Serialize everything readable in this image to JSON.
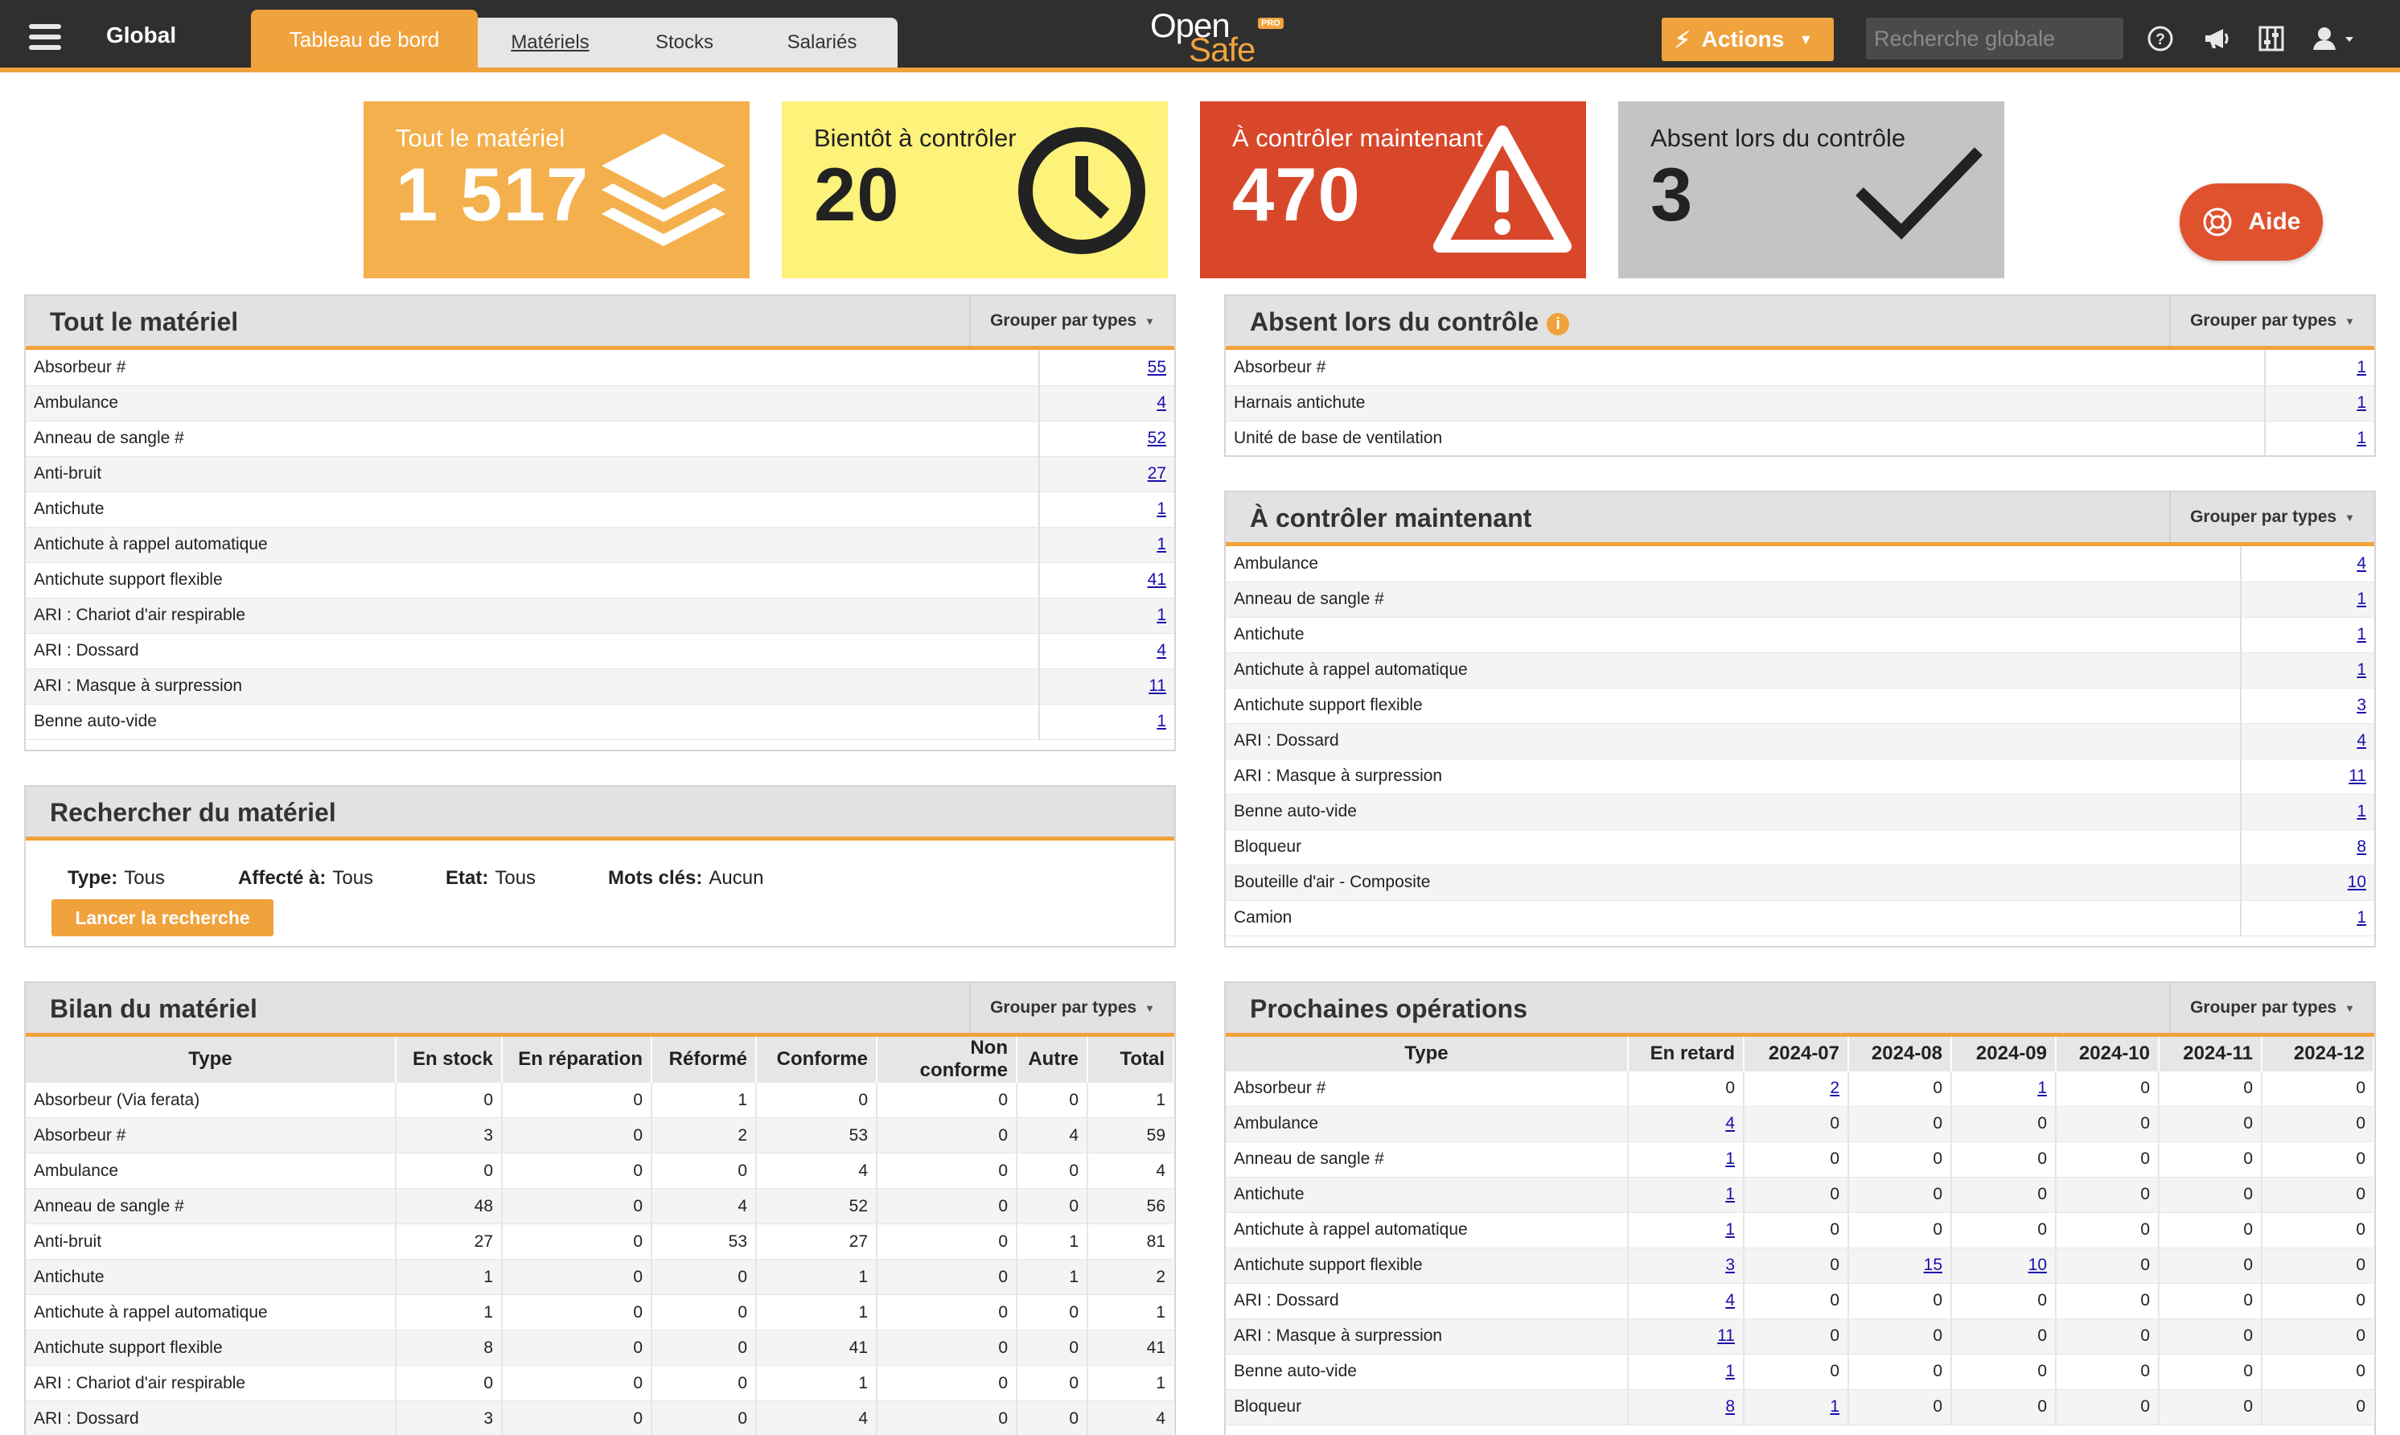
{
  "header": {
    "context": "Global",
    "tabs": [
      {
        "label": "Tableau de bord"
      },
      {
        "label": "Matériels"
      },
      {
        "label": "Stocks"
      },
      {
        "label": "Salariés"
      }
    ],
    "logo_top": "Open",
    "logo_bottom": "Safe",
    "logo_badge": "PRO",
    "actions_label": "Actions",
    "search_placeholder": "Recherche globale",
    "accent_color": "#f0a23c"
  },
  "kpis": [
    {
      "title": "Tout le matériel",
      "value": "1 517",
      "icon": "layers-icon",
      "color": "#f3b04c"
    },
    {
      "title": "Bientôt à contrôler",
      "value": "20",
      "icon": "clock-icon",
      "color": "#fdf27a"
    },
    {
      "title": "À contrôler maintenant",
      "value": "470",
      "icon": "warning-icon",
      "color": "#d9472b"
    },
    {
      "title": "Absent lors du contrôle",
      "value": "3",
      "icon": "check-icon",
      "color": "#c4c4c4"
    }
  ],
  "help_label": "Aide",
  "group_label": "Grouper par types",
  "all_equipment": {
    "title": "Tout le matériel",
    "rows": [
      {
        "type": "Absorbeur #",
        "count": "55"
      },
      {
        "type": "Ambulance",
        "count": "4"
      },
      {
        "type": "Anneau de sangle #",
        "count": "52"
      },
      {
        "type": "Anti-bruit",
        "count": "27"
      },
      {
        "type": "Antichute",
        "count": "1"
      },
      {
        "type": "Antichute à rappel automatique",
        "count": "1"
      },
      {
        "type": "Antichute support flexible",
        "count": "41"
      },
      {
        "type": "ARI : Chariot d'air respirable",
        "count": "1"
      },
      {
        "type": "ARI : Dossard",
        "count": "4"
      },
      {
        "type": "ARI : Masque à surpression",
        "count": "11"
      },
      {
        "type": "Benne auto-vide",
        "count": "1"
      }
    ]
  },
  "absent": {
    "title": "Absent lors du contrôle",
    "rows": [
      {
        "type": "Absorbeur #",
        "count": "1"
      },
      {
        "type": "Harnais antichute",
        "count": "1"
      },
      {
        "type": "Unité de base de ventilation",
        "count": "1"
      }
    ]
  },
  "to_check": {
    "title": "À contrôler maintenant",
    "rows": [
      {
        "type": "Ambulance",
        "count": "4"
      },
      {
        "type": "Anneau de sangle #",
        "count": "1"
      },
      {
        "type": "Antichute",
        "count": "1"
      },
      {
        "type": "Antichute à rappel automatique",
        "count": "1"
      },
      {
        "type": "Antichute support flexible",
        "count": "3"
      },
      {
        "type": "ARI : Dossard",
        "count": "4"
      },
      {
        "type": "ARI : Masque à surpression",
        "count": "11"
      },
      {
        "type": "Benne auto-vide",
        "count": "1"
      },
      {
        "type": "Bloqueur",
        "count": "8"
      },
      {
        "type": "Bouteille d'air - Composite",
        "count": "10"
      },
      {
        "type": "Camion",
        "count": "1"
      }
    ]
  },
  "search_panel": {
    "title": "Rechercher du matériel",
    "criteria": [
      {
        "label": "Type:",
        "value": "Tous"
      },
      {
        "label": "Affecté à:",
        "value": "Tous"
      },
      {
        "label": "Etat:",
        "value": "Tous"
      },
      {
        "label": "Mots clés:",
        "value": "Aucun"
      }
    ],
    "button": "Lancer la recherche"
  },
  "summary": {
    "title": "Bilan du matériel",
    "columns": [
      "Type",
      "En stock",
      "En réparation",
      "Réformé",
      "Conforme",
      "Non conforme",
      "Autre",
      "Total"
    ],
    "rows": [
      [
        "Absorbeur (Via ferata)",
        "0",
        "0",
        "1",
        "0",
        "0",
        "0",
        "1"
      ],
      [
        "Absorbeur #",
        "3",
        "0",
        "2",
        "53",
        "0",
        "4",
        "59"
      ],
      [
        "Ambulance",
        "0",
        "0",
        "0",
        "4",
        "0",
        "0",
        "4"
      ],
      [
        "Anneau de sangle #",
        "48",
        "0",
        "4",
        "52",
        "0",
        "0",
        "56"
      ],
      [
        "Anti-bruit",
        "27",
        "0",
        "53",
        "27",
        "0",
        "1",
        "81"
      ],
      [
        "Antichute",
        "1",
        "0",
        "0",
        "1",
        "0",
        "1",
        "2"
      ],
      [
        "Antichute à rappel automatique",
        "1",
        "0",
        "0",
        "1",
        "0",
        "0",
        "1"
      ],
      [
        "Antichute support flexible",
        "8",
        "0",
        "0",
        "41",
        "0",
        "0",
        "41"
      ],
      [
        "ARI : Chariot d'air respirable",
        "0",
        "0",
        "0",
        "1",
        "0",
        "0",
        "1"
      ],
      [
        "ARI : Dossard",
        "3",
        "0",
        "0",
        "4",
        "0",
        "0",
        "4"
      ]
    ]
  },
  "upcoming": {
    "title": "Prochaines opérations",
    "columns": [
      "Type",
      "En retard",
      "2024-07",
      "2024-08",
      "2024-09",
      "2024-10",
      "2024-11",
      "2024-12"
    ],
    "rows": [
      [
        "Absorbeur #",
        "0",
        "2",
        "0",
        "1",
        "0",
        "0",
        "0"
      ],
      [
        "Ambulance",
        "4",
        "0",
        "0",
        "0",
        "0",
        "0",
        "0"
      ],
      [
        "Anneau de sangle #",
        "1",
        "0",
        "0",
        "0",
        "0",
        "0",
        "0"
      ],
      [
        "Antichute",
        "1",
        "0",
        "0",
        "0",
        "0",
        "0",
        "0"
      ],
      [
        "Antichute à rappel automatique",
        "1",
        "0",
        "0",
        "0",
        "0",
        "0",
        "0"
      ],
      [
        "Antichute support flexible",
        "3",
        "0",
        "15",
        "10",
        "0",
        "0",
        "0"
      ],
      [
        "ARI : Dossard",
        "4",
        "0",
        "0",
        "0",
        "0",
        "0",
        "0"
      ],
      [
        "ARI : Masque à surpression",
        "11",
        "0",
        "0",
        "0",
        "0",
        "0",
        "0"
      ],
      [
        "Benne auto-vide",
        "1",
        "0",
        "0",
        "0",
        "0",
        "0",
        "0"
      ],
      [
        "Bloqueur",
        "8",
        "1",
        "0",
        "0",
        "0",
        "0",
        "0"
      ]
    ]
  }
}
